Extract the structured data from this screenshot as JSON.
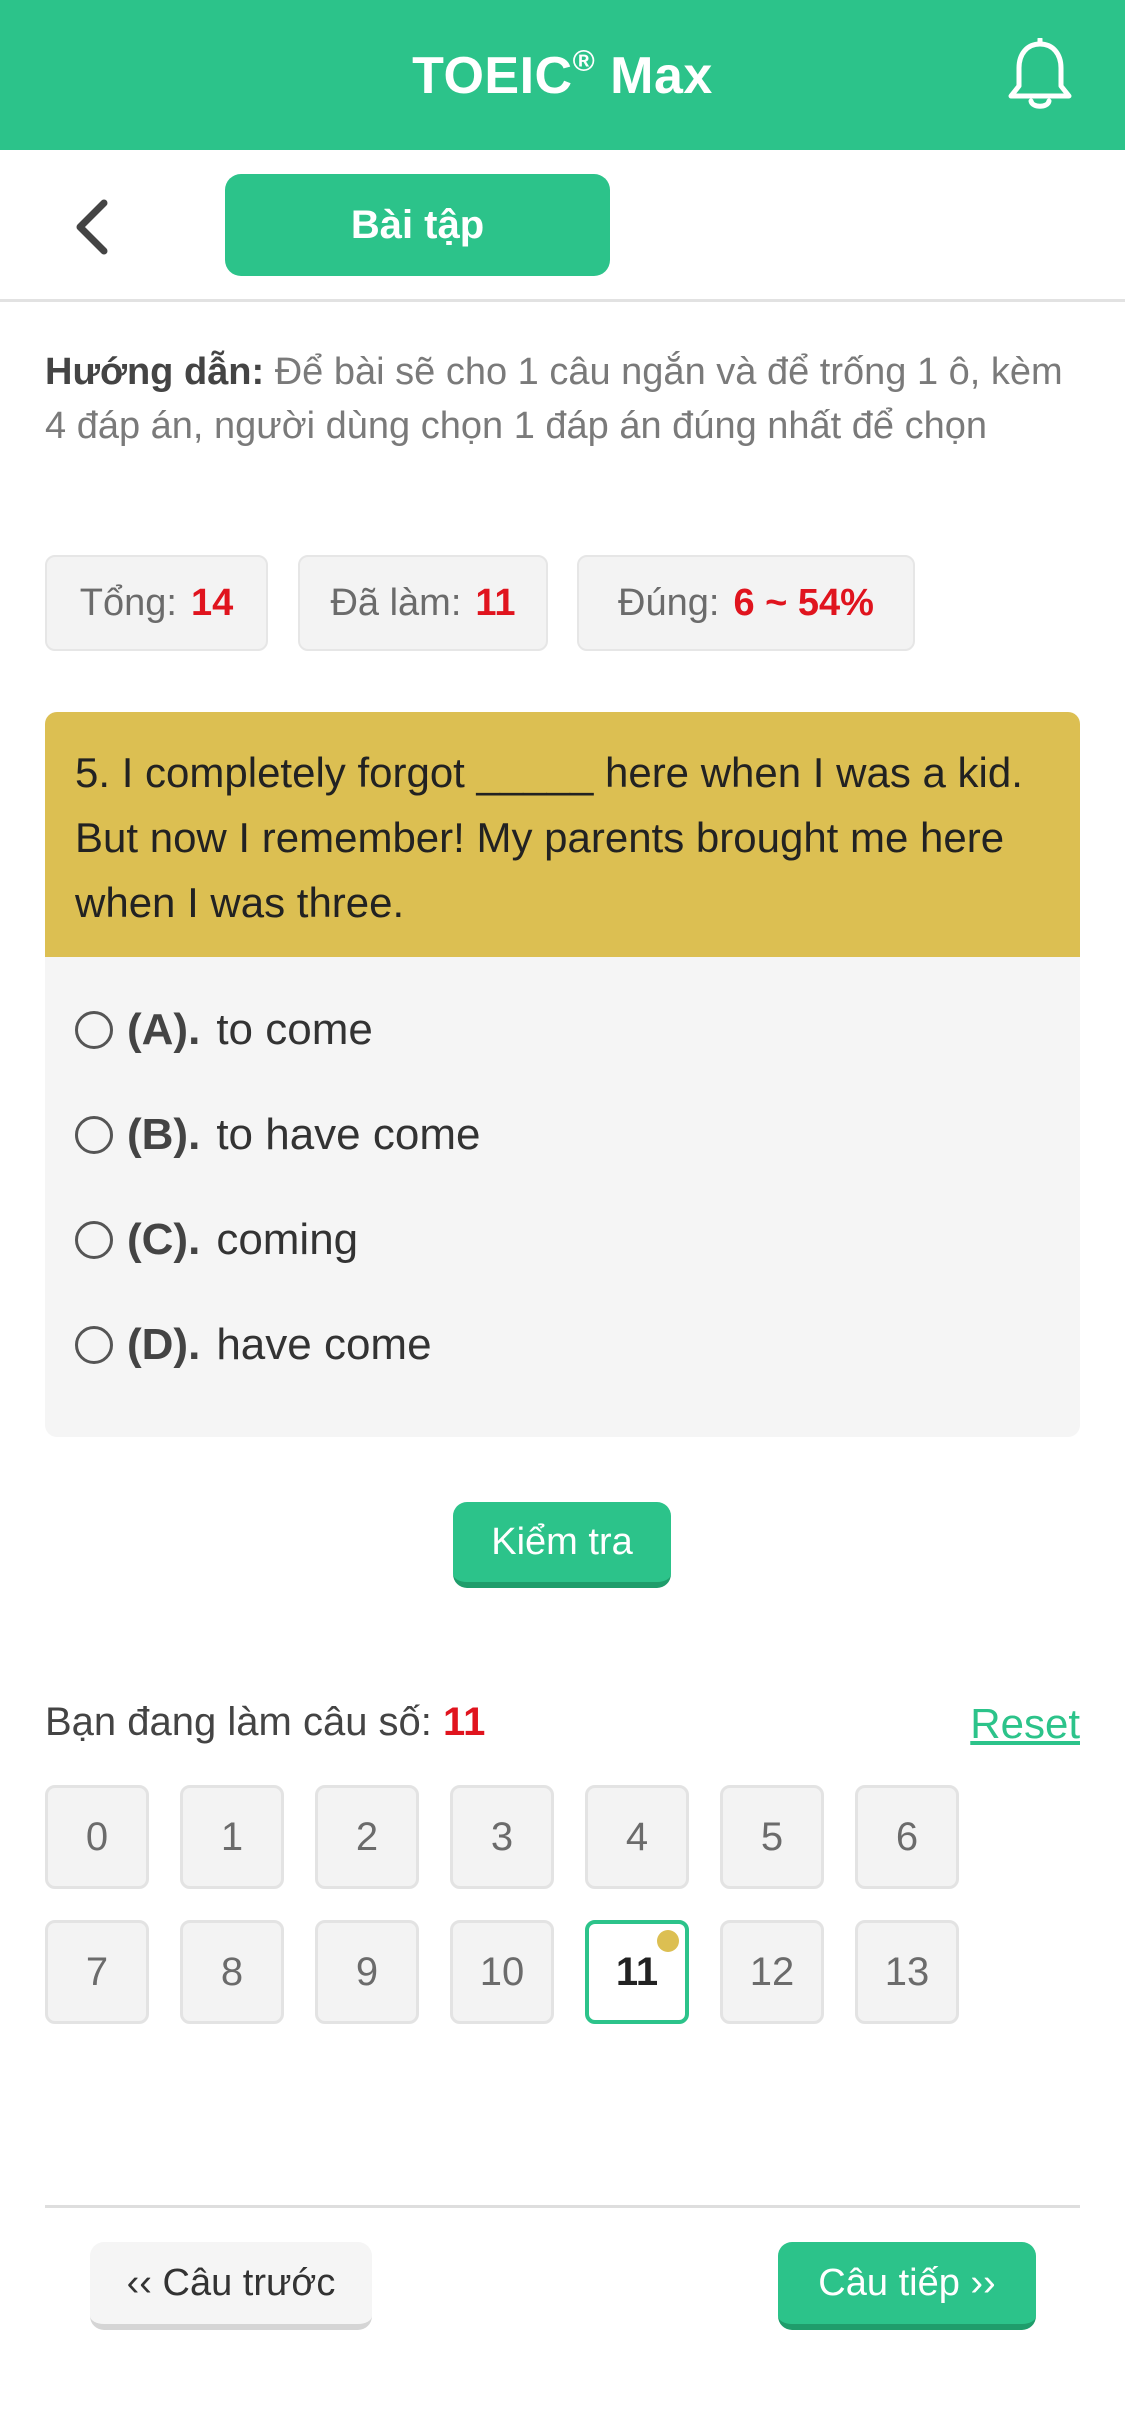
{
  "header": {
    "title": "TOEIC",
    "title_mark": "®",
    "title_suffix": " Max",
    "notification_icon": "bell-icon"
  },
  "subheader": {
    "back_icon": "chevron-left-icon",
    "tab_label": "Bài tập"
  },
  "instruction": {
    "label": "Hướng dẫn:",
    "text": " Để bài sẽ cho 1 câu ngắn và để trống 1 ô, kèm 4 đáp án, người dùng chọn 1 đáp án đúng nhất để chọn"
  },
  "stats": {
    "total_label": "Tổng:",
    "total_value": "14",
    "done_label": "Đã làm:",
    "done_value": "11",
    "correct_label": "Đúng:",
    "correct_value": "6 ~ 54%"
  },
  "question": {
    "text": "5. I completely forgot _____ here when I was a kid. But now I remember! My parents brought me here when I was three.",
    "options": [
      {
        "key": "(A).",
        "text": "to come"
      },
      {
        "key": "(B).",
        "text": "to have come"
      },
      {
        "key": "(C).",
        "text": "coming"
      },
      {
        "key": "(D).",
        "text": "have come"
      }
    ]
  },
  "check_button": "Kiểm tra",
  "progress": {
    "label": "Bạn đang làm câu số: ",
    "current": "11",
    "reset_label": "Reset"
  },
  "question_numbers": [
    "0",
    "1",
    "2",
    "3",
    "4",
    "5",
    "6",
    "7",
    "8",
    "9",
    "10",
    "11",
    "12",
    "13"
  ],
  "active_number": "11",
  "footer": {
    "prev_label": "‹‹ Câu trước",
    "next_label": "Câu tiếp ››"
  },
  "colors": {
    "primary": "#2cc38a",
    "question_bg": "#dcbf52",
    "highlight": "#e0141e"
  }
}
